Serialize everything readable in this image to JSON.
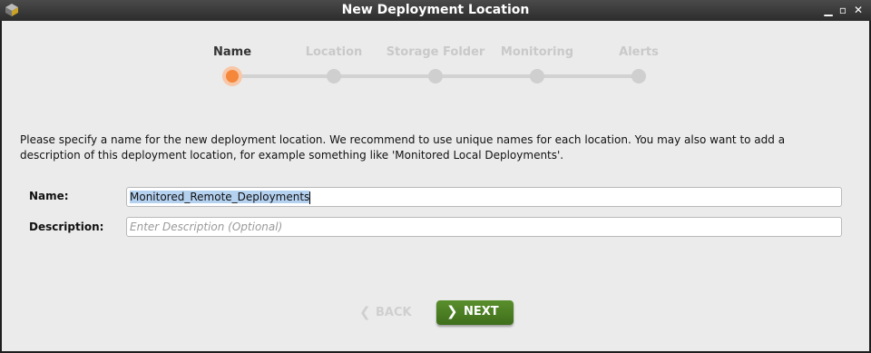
{
  "window": {
    "title": "New Deployment Location"
  },
  "steps": [
    {
      "label": "Name",
      "active": true
    },
    {
      "label": "Location",
      "active": false
    },
    {
      "label": "Storage Folder",
      "active": false
    },
    {
      "label": "Monitoring",
      "active": false
    },
    {
      "label": "Alerts",
      "active": false
    }
  ],
  "description": "Please specify a name for the new deployment location. We recommend to use unique names for each location. You may also want to add a description of this deployment location, for example something like 'Monitored Local Deployments'.",
  "form": {
    "name_label": "Name:",
    "name_value": "Monitored_Remote_Deployments",
    "description_label": "Description:",
    "description_placeholder": "Enter Description (Optional)"
  },
  "buttons": {
    "back": "BACK",
    "next": "NEXT"
  },
  "colors": {
    "accent": "#f5873a",
    "next_button": "#4a7c22",
    "title_bar": "#333333"
  }
}
